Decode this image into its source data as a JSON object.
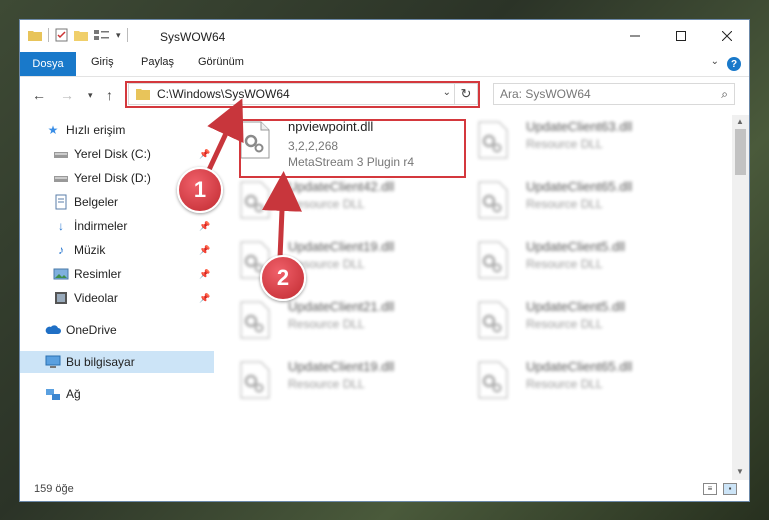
{
  "window": {
    "title": "SysWOW64"
  },
  "ribbon": {
    "tabs": [
      "Dosya",
      "Giriş",
      "Paylaş",
      "Görünüm"
    ],
    "help": "?"
  },
  "nav": {
    "address": "C:\\Windows\\SysWOW64",
    "search_placeholder": "Ara: SysWOW64"
  },
  "sidebar": {
    "items": [
      {
        "label": "Hızlı erişim",
        "icon": "star-icon"
      },
      {
        "label": "Yerel Disk (C:)",
        "icon": "drive-icon",
        "pinned": true
      },
      {
        "label": "Yerel Disk (D:)",
        "icon": "drive-icon",
        "pinned": true
      },
      {
        "label": "Belgeler",
        "icon": "documents-icon",
        "pinned": true
      },
      {
        "label": "İndirmeler",
        "icon": "download-icon",
        "pinned": true
      },
      {
        "label": "Müzik",
        "icon": "music-icon",
        "pinned": true
      },
      {
        "label": "Resimler",
        "icon": "pictures-icon",
        "pinned": true
      },
      {
        "label": "Videolar",
        "icon": "video-icon",
        "pinned": true
      },
      {
        "label": "OneDrive",
        "icon": "cloud-icon"
      },
      {
        "label": "Bu bilgisayar",
        "icon": "computer-icon",
        "selected": true
      },
      {
        "label": "Ağ",
        "icon": "network-icon"
      }
    ]
  },
  "files": {
    "highlighted": {
      "name": "npviewpoint.dll",
      "version": "3,2,2,268",
      "desc": "MetaStream 3 Plugin r4"
    },
    "left": [
      {
        "name": "UpdateClient42.dll",
        "type": "Resource DLL"
      },
      {
        "name": "UpdateClient19.dll",
        "type": "Resource DLL"
      },
      {
        "name": "UpdateClient21.dll",
        "type": "Resource DLL"
      },
      {
        "name": "UpdateClient19.dll",
        "type": "Resource DLL"
      }
    ],
    "right": [
      {
        "name": "UpdateClient63.dll",
        "type": "Resource DLL"
      },
      {
        "name": "UpdateClient65.dll",
        "type": "Resource DLL"
      },
      {
        "name": "UpdateClient5.dll",
        "type": "Resource DLL"
      },
      {
        "name": "UpdateClient5.dll",
        "type": "Resource DLL"
      },
      {
        "name": "UpdateClient65.dll",
        "type": "Resource DLL"
      }
    ]
  },
  "status": {
    "count": "159 öğe"
  },
  "callouts": [
    "1",
    "2"
  ],
  "colors": {
    "accent": "#1979ca",
    "highlight": "#d4383d",
    "selected": "#cce4f7"
  }
}
